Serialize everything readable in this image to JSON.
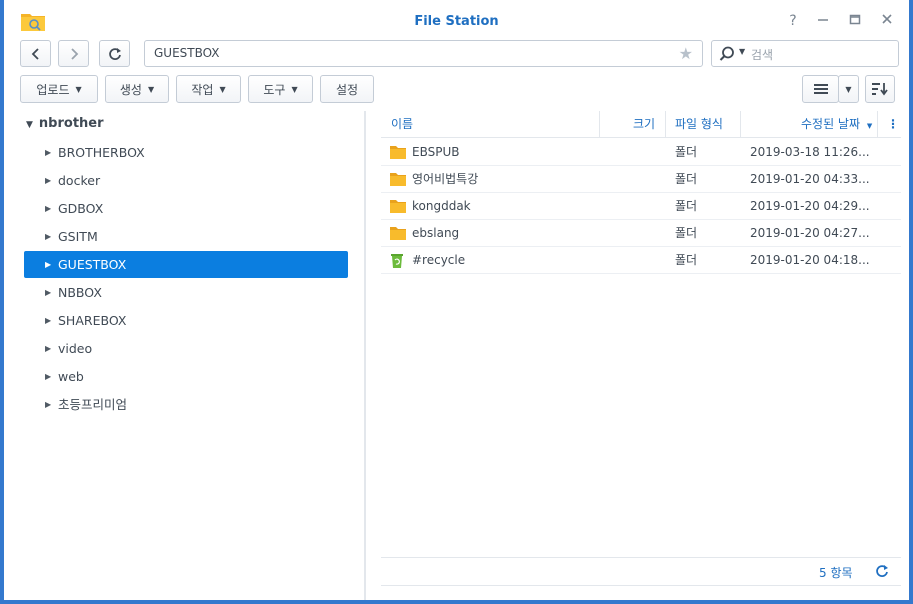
{
  "window": {
    "title": "File Station"
  },
  "controls": {
    "help": "?"
  },
  "nav": {
    "back_icon": "chevron-left-icon",
    "forward_icon": "chevron-right-icon",
    "refresh_icon": "refresh-icon",
    "path": "GUESTBOX",
    "bookmark_icon": "star-icon"
  },
  "search": {
    "placeholder": "검색"
  },
  "toolbar": {
    "upload": "업로드",
    "create": "생성",
    "action": "작업",
    "tools": "도구",
    "settings": "설정"
  },
  "tree": {
    "root": "nbrother",
    "items": [
      {
        "label": "BROTHERBOX"
      },
      {
        "label": "docker"
      },
      {
        "label": "GDBOX"
      },
      {
        "label": "GSITM"
      },
      {
        "label": "GUESTBOX"
      },
      {
        "label": "NBBOX"
      },
      {
        "label": "SHAREBOX"
      },
      {
        "label": "video"
      },
      {
        "label": "web"
      },
      {
        "label": "초등프리미엄"
      }
    ],
    "selected": "GUESTBOX"
  },
  "list": {
    "columns": {
      "name": "이름",
      "size": "크기",
      "type": "파일 형식",
      "modified": "수정된 날짜"
    },
    "rows": [
      {
        "name": "EBSPUB",
        "type": "폴더",
        "modified": "2019-03-18 11:26...",
        "icon": "folder-icon"
      },
      {
        "name": "영어비법특강",
        "type": "폴더",
        "modified": "2019-01-20 04:33...",
        "icon": "folder-icon"
      },
      {
        "name": "kongddak",
        "type": "폴더",
        "modified": "2019-01-20 04:29...",
        "icon": "folder-icon"
      },
      {
        "name": "ebslang",
        "type": "폴더",
        "modified": "2019-01-20 04:27...",
        "icon": "folder-icon"
      },
      {
        "name": "#recycle",
        "type": "폴더",
        "modified": "2019-01-20 04:18...",
        "icon": "recycle-bin-icon"
      }
    ]
  },
  "footer": {
    "count": "5 항목"
  },
  "colors": {
    "accent": "#1f6fc1",
    "selection": "#0b7ee0",
    "folder": "#f5b428",
    "recycle": "#6cbb3c",
    "frame": "#3479ce"
  }
}
